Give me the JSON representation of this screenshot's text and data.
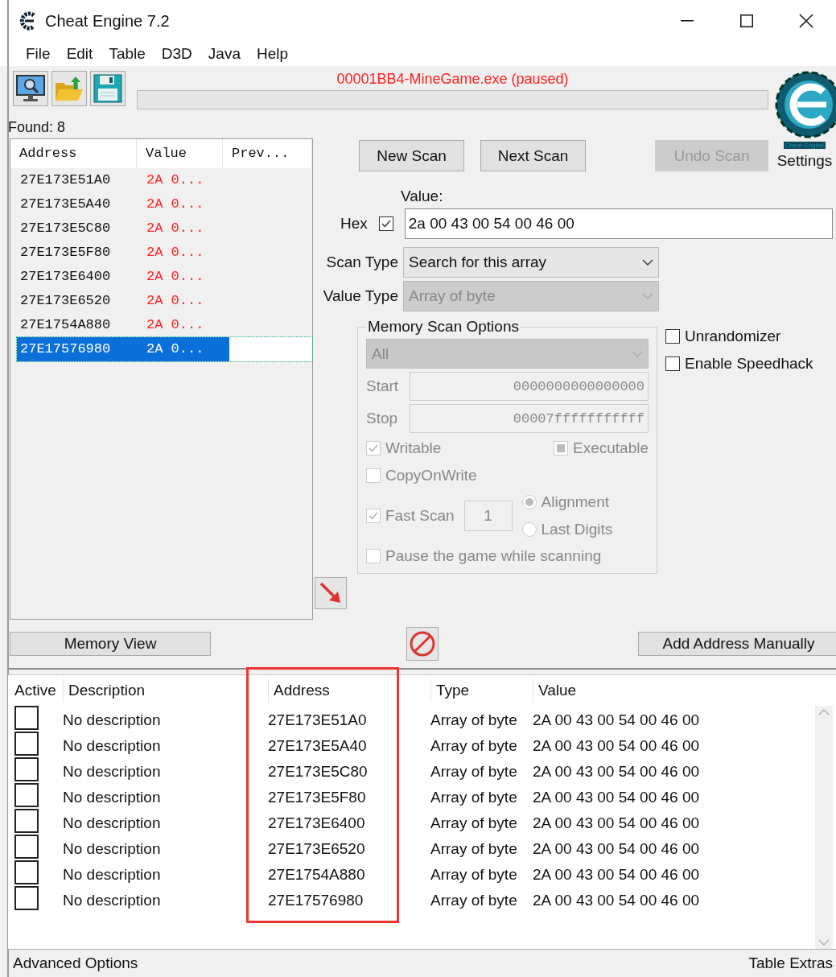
{
  "window": {
    "title": "Cheat Engine 7.2"
  },
  "menu": [
    "File",
    "Edit",
    "Table",
    "D3D",
    "Java",
    "Help"
  ],
  "process": "00001BB4-MineGame.exe (paused)",
  "logo": {
    "caption": "Cheat Engine",
    "label": "Settings"
  },
  "found": "Found: 8",
  "results": {
    "columns": [
      "Address",
      "Value",
      "Prev..."
    ],
    "rows": [
      {
        "address": "27E173E51A0",
        "value": "2A 0...",
        "selected": false
      },
      {
        "address": "27E173E5A40",
        "value": "2A 0...",
        "selected": false
      },
      {
        "address": "27E173E5C80",
        "value": "2A 0...",
        "selected": false
      },
      {
        "address": "27E173E5F80",
        "value": "2A 0...",
        "selected": false
      },
      {
        "address": "27E173E6400",
        "value": "2A 0...",
        "selected": false
      },
      {
        "address": "27E173E6520",
        "value": "2A 0...",
        "selected": false
      },
      {
        "address": "27E1754A880",
        "value": "2A 0...",
        "selected": false
      },
      {
        "address": "27E17576980",
        "value": "2A 0...",
        "selected": true
      }
    ]
  },
  "scan_buttons": [
    {
      "label": "New Scan",
      "disabled": false
    },
    {
      "label": "Next Scan",
      "disabled": false
    },
    {
      "label": "Undo Scan",
      "disabled": true
    }
  ],
  "value": {
    "label": "Value:",
    "hex_label": "Hex",
    "hex_checked": true,
    "text": "2a 00 43 00 54 00 46 00"
  },
  "scan_type": {
    "label": "Scan Type",
    "value": "Search for this array",
    "disabled": false
  },
  "value_type": {
    "label": "Value Type",
    "value": "Array of byte",
    "disabled": true
  },
  "memory_scan_options": {
    "title": "Memory Scan Options",
    "disabled": true,
    "region": "All",
    "start_label": "Start",
    "start": "0000000000000000",
    "stop_label": "Stop",
    "stop": "00007fffffffffff",
    "writable": {
      "label": "Writable",
      "checked": true
    },
    "executable": {
      "label": "Executable",
      "indeterminate": true
    },
    "copy_on_write": {
      "label": "CopyOnWrite",
      "checked": false
    },
    "fast_scan": {
      "label": "Fast Scan",
      "checked": true,
      "digits": "1"
    },
    "alignment_modes": [
      {
        "label": "Alignment",
        "selected": true
      },
      {
        "label": "Last Digits",
        "selected": false
      }
    ],
    "pause": {
      "label": "Pause the game while scanning",
      "checked": false
    }
  },
  "extras": [
    {
      "label": "Unrandomizer",
      "checked": false
    },
    {
      "label": "Enable Speedhack",
      "checked": false
    }
  ],
  "memory_view": "Memory View",
  "add_address": "Add Address Manually",
  "address_list": {
    "columns": [
      "Active",
      "Description",
      "Address",
      "Type",
      "Value"
    ],
    "rows": [
      {
        "active": false,
        "description": "No description",
        "address": "27E173E51A0",
        "type": "Array of byte",
        "value": "2A 00 43 00 54 00 46 00"
      },
      {
        "active": false,
        "description": "No description",
        "address": "27E173E5A40",
        "type": "Array of byte",
        "value": "2A 00 43 00 54 00 46 00"
      },
      {
        "active": false,
        "description": "No description",
        "address": "27E173E5C80",
        "type": "Array of byte",
        "value": "2A 00 43 00 54 00 46 00"
      },
      {
        "active": false,
        "description": "No description",
        "address": "27E173E5F80",
        "type": "Array of byte",
        "value": "2A 00 43 00 54 00 46 00"
      },
      {
        "active": false,
        "description": "No description",
        "address": "27E173E6400",
        "type": "Array of byte",
        "value": "2A 00 43 00 54 00 46 00"
      },
      {
        "active": false,
        "description": "No description",
        "address": "27E173E6520",
        "type": "Array of byte",
        "value": "2A 00 43 00 54 00 46 00"
      },
      {
        "active": false,
        "description": "No description",
        "address": "27E1754A880",
        "type": "Array of byte",
        "value": "2A 00 43 00 54 00 46 00"
      },
      {
        "active": false,
        "description": "No description",
        "address": "27E17576980",
        "type": "Array of byte",
        "value": "2A 00 43 00 54 00 46 00"
      }
    ]
  },
  "status_bar": {
    "left": "Advanced Options",
    "right": "Table Extras"
  }
}
